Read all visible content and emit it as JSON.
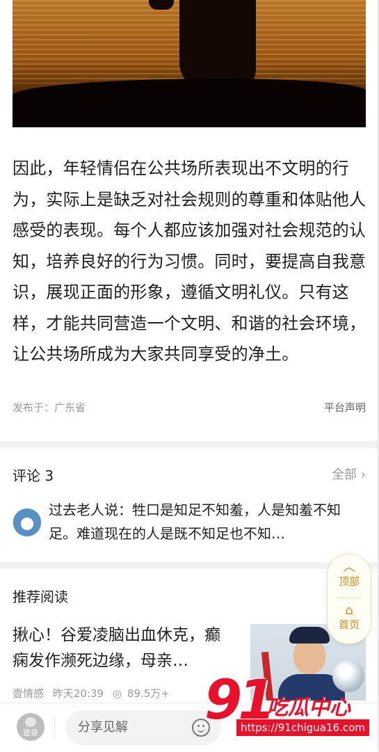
{
  "article": {
    "paragraph": "因此，年轻情侣在公共场所表现出不文明的行为，实际上是缺乏对社会规则的尊重和体贴他人感受的表现。每个人都应该加强对社会规范的认知，培养良好的行为习惯。同时，要提高自我意识，展现正面的形象，遵循文明礼仪。只有这样，才能共同营造一个文明、和谐的社会环境，让公共场所成为大家共同享受的净土。",
    "published_location": "发布于：广东省",
    "platform_statement": "平台声明"
  },
  "comments": {
    "title": "评论 3",
    "all_label": "全部",
    "first_comment": "过去老人说：牲口是知足不知羞，人是知羞不知足。难道现在的人是既不知足也不知…"
  },
  "float_nav": {
    "top_label": "顶部",
    "home_label": "首页"
  },
  "recommended": {
    "heading": "推荐阅读",
    "item": {
      "title": "揪心！谷爱凌脑出血休克，癫痫发作濒死边缘，母亲…",
      "source": "壹情感",
      "time": "昨天20:39",
      "views": "89.5万+"
    }
  },
  "bottom_bar": {
    "login_label": "登录",
    "comment_placeholder": "分享见解"
  },
  "watermark": {
    "number": "91",
    "name": "吃瓜中心",
    "url": "https://91chigua16.com"
  }
}
